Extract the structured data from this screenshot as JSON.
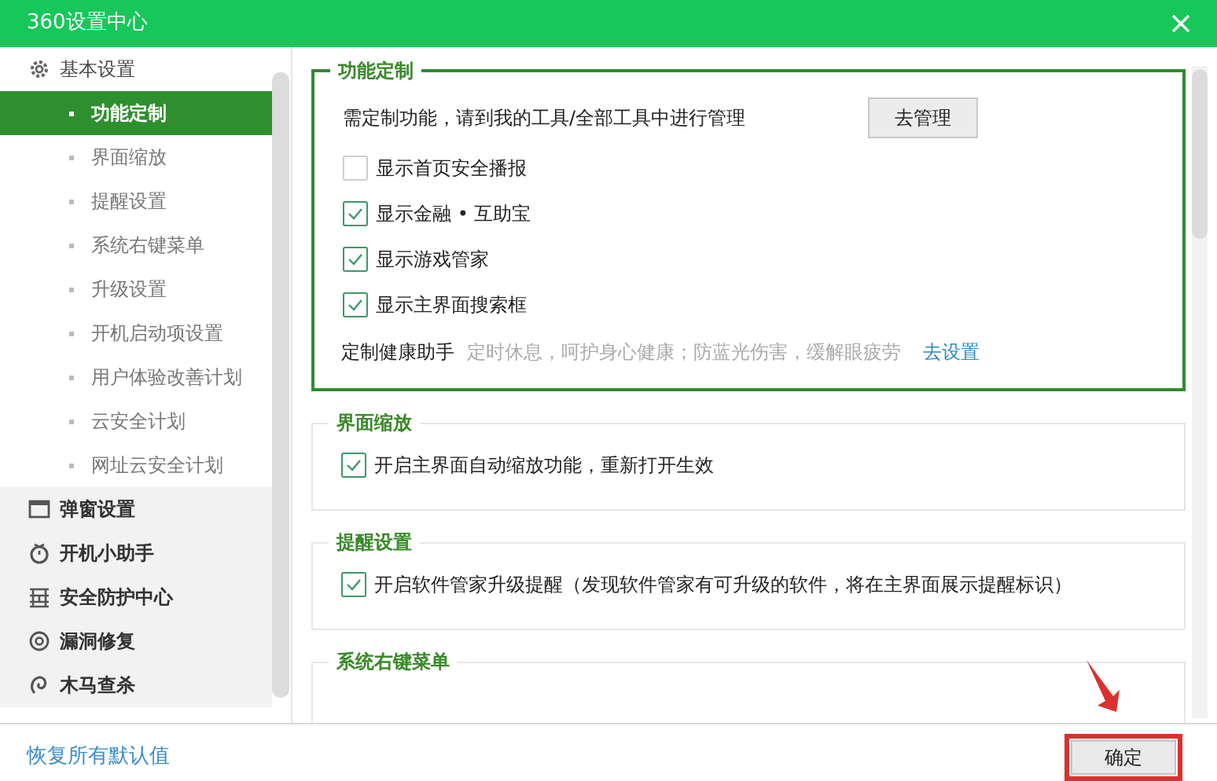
{
  "window": {
    "title": "360设置中心"
  },
  "sidebar": {
    "groups": [
      {
        "label": "基本设置",
        "expanded": true,
        "children": [
          {
            "label": "功能定制",
            "selected": true
          },
          {
            "label": "界面缩放",
            "selected": false
          },
          {
            "label": "提醒设置",
            "selected": false
          },
          {
            "label": "系统右键菜单",
            "selected": false
          },
          {
            "label": "升级设置",
            "selected": false
          },
          {
            "label": "开机启动项设置",
            "selected": false
          },
          {
            "label": "用户体验改善计划",
            "selected": false
          },
          {
            "label": "云安全计划",
            "selected": false
          },
          {
            "label": "网址云安全计划",
            "selected": false
          }
        ]
      },
      {
        "label": "弹窗设置",
        "expanded": false
      },
      {
        "label": "开机小助手",
        "expanded": false
      },
      {
        "label": "安全防护中心",
        "expanded": false
      },
      {
        "label": "漏洞修复",
        "expanded": false
      },
      {
        "label": "木马查杀",
        "expanded": false
      }
    ]
  },
  "sections": [
    {
      "title": "功能定制",
      "selected": true,
      "rows": [
        {
          "kind": "action",
          "text": "需定制功能，请到我的工具/全部工具中进行管理",
          "button": "去管理"
        },
        {
          "kind": "checkbox",
          "text": "显示首页安全播报",
          "checked": false
        },
        {
          "kind": "checkbox",
          "text": "显示金融 • 互助宝",
          "checked": true
        },
        {
          "kind": "checkbox",
          "text": "显示游戏管家",
          "checked": true
        },
        {
          "kind": "checkbox",
          "text": "显示主界面搜索框",
          "checked": true
        },
        {
          "kind": "hint",
          "label": "定制健康助手",
          "text": "定时休息，呵护身心健康；防蓝光伤害，缓解眼疲劳",
          "link": "去设置"
        }
      ]
    },
    {
      "title": "界面缩放",
      "selected": false,
      "rows": [
        {
          "kind": "checkbox",
          "text": "开启主界面自动缩放功能，重新打开生效",
          "checked": true
        }
      ]
    },
    {
      "title": "提醒设置",
      "selected": false,
      "rows": [
        {
          "kind": "checkbox",
          "text": "开启软件管家升级提醒（发现软件管家有可升级的软件，将在主界面展示提醒标识）",
          "checked": true
        }
      ]
    },
    {
      "title": "系统右键菜单",
      "selected": false
    }
  ],
  "footer": {
    "reset_link": "恢复所有默认值",
    "ok_button": {
      "label": "确定",
      "highlighted": true
    }
  }
}
